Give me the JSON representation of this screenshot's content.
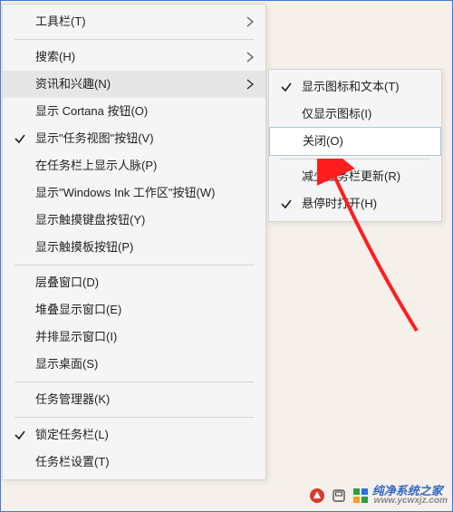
{
  "menu": {
    "items": [
      {
        "label": "工具栏(T)",
        "has_submenu": true
      },
      {
        "separator": true
      },
      {
        "label": "搜索(H)",
        "has_submenu": true
      },
      {
        "label": "资讯和兴趣(N)",
        "has_submenu": true,
        "highlight": true
      },
      {
        "label": "显示 Cortana 按钮(O)"
      },
      {
        "label": "显示\"任务视图\"按钮(V)",
        "checked": true
      },
      {
        "label": "在任务栏上显示人脉(P)"
      },
      {
        "label": "显示\"Windows Ink 工作区\"按钮(W)"
      },
      {
        "label": "显示触摸键盘按钮(Y)"
      },
      {
        "label": "显示触摸板按钮(P)"
      },
      {
        "separator": true
      },
      {
        "label": "层叠窗口(D)"
      },
      {
        "label": "堆叠显示窗口(E)"
      },
      {
        "label": "并排显示窗口(I)"
      },
      {
        "label": "显示桌面(S)"
      },
      {
        "separator": true
      },
      {
        "label": "任务管理器(K)"
      },
      {
        "separator": true
      },
      {
        "label": "锁定任务栏(L)",
        "checked": true
      },
      {
        "label": "任务栏设置(T)"
      }
    ]
  },
  "submenu": {
    "items": [
      {
        "label": "显示图标和文本(T)",
        "checked": true
      },
      {
        "label": "仅显示图标(I)"
      },
      {
        "label": "关闭(O)",
        "highlight": true
      },
      {
        "separator": true
      },
      {
        "label": "减少任务栏更新(R)"
      },
      {
        "label": "悬停时打开(H)",
        "checked": true
      }
    ]
  },
  "tray": {
    "avast_icon": "avast-icon",
    "device_icon": "device-icon"
  },
  "brand": {
    "logo": "windows-logo",
    "name": "纯净系统之家",
    "url": "www.ycwxjz.com"
  },
  "annotation": {
    "arrow_color": "#ff1e1e"
  }
}
